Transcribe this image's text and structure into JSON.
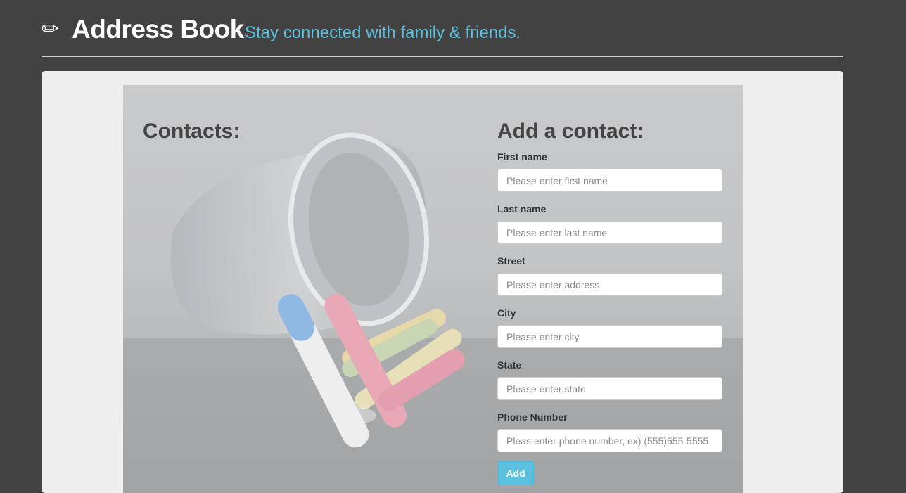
{
  "header": {
    "icon": "pencil-icon",
    "icon_glyph": "✏",
    "title": "Address Book",
    "subtitle": "Stay connected with family & friends."
  },
  "contacts": {
    "heading": "Contacts:"
  },
  "form": {
    "heading": "Add a contact:",
    "fields": [
      {
        "label": "First name",
        "placeholder": "Please enter first name",
        "value": ""
      },
      {
        "label": "Last name",
        "placeholder": "Please enter last name",
        "value": ""
      },
      {
        "label": "Street",
        "placeholder": "Please enter address",
        "value": ""
      },
      {
        "label": "City",
        "placeholder": "Please enter city",
        "value": ""
      },
      {
        "label": "State",
        "placeholder": "Please enter state",
        "value": ""
      },
      {
        "label": "Phone Number",
        "placeholder": "Pleas enter phone number, ex) (555)555-5555",
        "value": ""
      }
    ],
    "submit_label": "Add"
  },
  "colors": {
    "page_background": "#424242",
    "accent": "#5bc0de",
    "panel_background": "#eeeeee"
  }
}
